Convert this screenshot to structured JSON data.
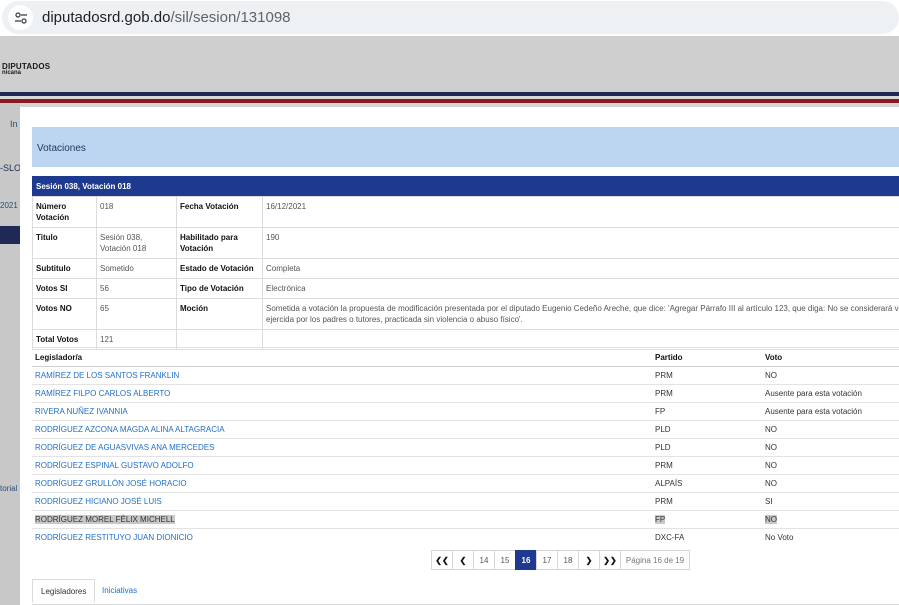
{
  "browser": {
    "url_host": "diputadosrd.gob.do",
    "url_path": "/sil/sesion/131098"
  },
  "background": {
    "logo_title": "DIPUTADOS",
    "logo_subtitle": "nicana",
    "side_texts": [
      "In",
      "-SLO",
      "2021 -",
      "torial"
    ]
  },
  "modal": {
    "title": "Votaciones",
    "section_header": "Sesión 038, Votación 018",
    "info": {
      "numero_label": "Número Votación",
      "numero_value": "018",
      "fecha_label": "Fecha Votación",
      "fecha_value": "16/12/2021",
      "titulo_label": "Titulo",
      "titulo_value": "Sesión 038, Votación 018",
      "habilitado_label": "Habilitado para Votación",
      "habilitado_value": "190",
      "subtitulo_label": "Subtitulo",
      "subtitulo_value": "Sometido",
      "estado_label": "Estado de Votación",
      "estado_value": "Completa",
      "si_label": "Votos SI",
      "si_value": "56",
      "tipo_label": "Tipo de Votación",
      "tipo_value": "Electrónica",
      "no_label": "Votos NO",
      "no_value": "65",
      "mocion_label": "Moción",
      "mocion_value": "Sometida a votación la propuesta de modificación presentada por el diputado Eugenio Cedeño Areche, que dice: 'Agregar Párrafo III al artículo 123, que diga: No se considerará vio ejercida por los padres o tutores, practicada sin violencia o abuso físico'.",
      "total_label": "Total Votos",
      "total_value": "121"
    },
    "votes_table": {
      "headers": {
        "legislador": "Legislador/a",
        "partido": "Partido",
        "voto": "Voto"
      },
      "rows": [
        {
          "name": "RAMÍREZ DE LOS SANTOS FRANKLIN",
          "party": "PRM",
          "vote": "NO"
        },
        {
          "name": "RAMÍREZ FILPO CARLOS ALBERTO",
          "party": "PRM",
          "vote": "Ausente para esta votación"
        },
        {
          "name": "RIVERA NUÑEZ IVANNIA",
          "party": "FP",
          "vote": "Ausente para esta votación"
        },
        {
          "name": "RODRÍGUEZ AZCONA MAGDA ALINA ALTAGRACIA",
          "party": "PLD",
          "vote": "NO"
        },
        {
          "name": "RODRÍGUEZ DE AGUASVIVAS ANA MERCEDES",
          "party": "PLD",
          "vote": "NO"
        },
        {
          "name": "RODRÍGUEZ ESPINAL GUSTAVO ADOLFO",
          "party": "PRM",
          "vote": "NO"
        },
        {
          "name": "RODRÍGUEZ GRULLÓN JOSÉ HORACIO",
          "party": "ALPAÍS",
          "vote": "NO"
        },
        {
          "name": "RODRÍGUEZ HICIANO JOSÉ LUIS",
          "party": "PRM",
          "vote": "SI"
        },
        {
          "name": "RODRÍGUEZ MOREL FÉLIX MICHELL",
          "party": "FP",
          "vote": "NO"
        },
        {
          "name": "RODRÍGUEZ RESTITUYO JUAN DIONICIO",
          "party": "DXC-FA",
          "vote": "No Voto"
        }
      ]
    },
    "pagination": {
      "pages": [
        "14",
        "15",
        "16",
        "17",
        "18"
      ],
      "current": "16",
      "info": "Página 16 de 19"
    },
    "tabs": {
      "legisladores": "Legisladores",
      "iniciativas": "Iniciativas"
    }
  },
  "colors": {
    "header_navy": "#1e3a8f",
    "title_bar": "#bcd5f1",
    "link_blue": "#1f6fc9"
  }
}
